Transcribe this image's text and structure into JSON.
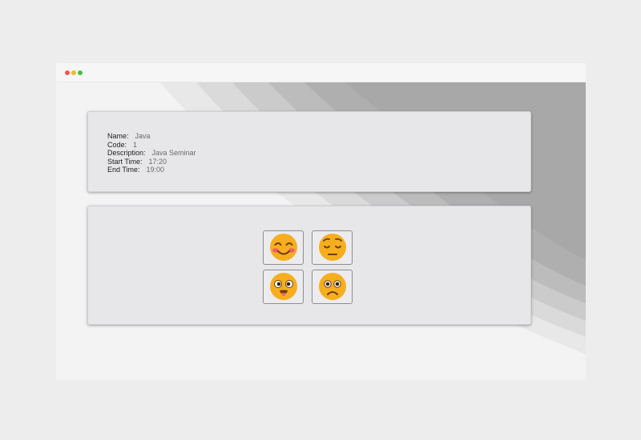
{
  "window": {
    "controls": [
      "close",
      "minimize",
      "maximize"
    ]
  },
  "event": {
    "fields": [
      {
        "label": "Name:",
        "value": "Java"
      },
      {
        "label": "Code:",
        "value": "1"
      },
      {
        "label": "Description:",
        "value": "Java Seminar"
      },
      {
        "label": "Start Time:",
        "value": "17:20"
      },
      {
        "label": "End Time:",
        "value": "19:00"
      }
    ]
  },
  "feedback": {
    "options": [
      {
        "icon": "smiling-blushing-face-icon"
      },
      {
        "icon": "pensive-face-icon"
      },
      {
        "icon": "face-with-tongue-icon"
      },
      {
        "icon": "frowning-face-icon"
      }
    ]
  },
  "colors": {
    "emoji_yellow": "#f6ae1f",
    "card_bg": "#e7e6e8",
    "window_bg": "#f3f3f4"
  }
}
